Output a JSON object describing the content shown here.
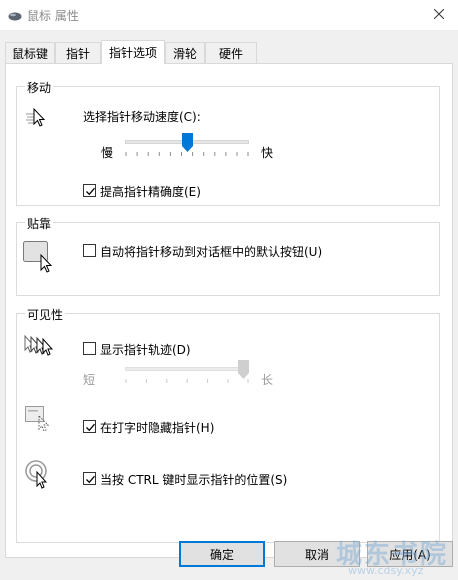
{
  "window": {
    "title": "鼠标 属性",
    "close_icon": "close-icon"
  },
  "tabs": [
    {
      "label": "鼠标键"
    },
    {
      "label": "指针"
    },
    {
      "label": "指针选项",
      "active": true
    },
    {
      "label": "滑轮"
    },
    {
      "label": "硬件"
    }
  ],
  "motion": {
    "title": "移动",
    "speed_label": "选择指针移动速度(C):",
    "slow_label": "慢",
    "fast_label": "快",
    "speed_level": 0.5,
    "precision_label": "提高指针精确度(E)",
    "precision_checked": true
  },
  "snap": {
    "title": "贴靠",
    "label": "自动将指针移动到对话框中的默认按钮(U)",
    "checked": false
  },
  "visibility": {
    "title": "可见性",
    "trails_label": "显示指针轨迹(D)",
    "trails_checked": false,
    "short_label": "短",
    "long_label": "长",
    "trails_level": 1.0,
    "hide_label": "在打字时隐藏指针(H)",
    "hide_checked": true,
    "ctrl_label": "当按 CTRL 键时显示指针的位置(S)",
    "ctrl_checked": true
  },
  "buttons": {
    "ok": "确定",
    "cancel": "取消",
    "apply": "应用(A)"
  },
  "watermark": {
    "line1": "城东书院",
    "line2": "www.cdsy.xyz"
  },
  "colors": {
    "slider_thumb": "#0078d7",
    "default_border": "#0078d7"
  }
}
